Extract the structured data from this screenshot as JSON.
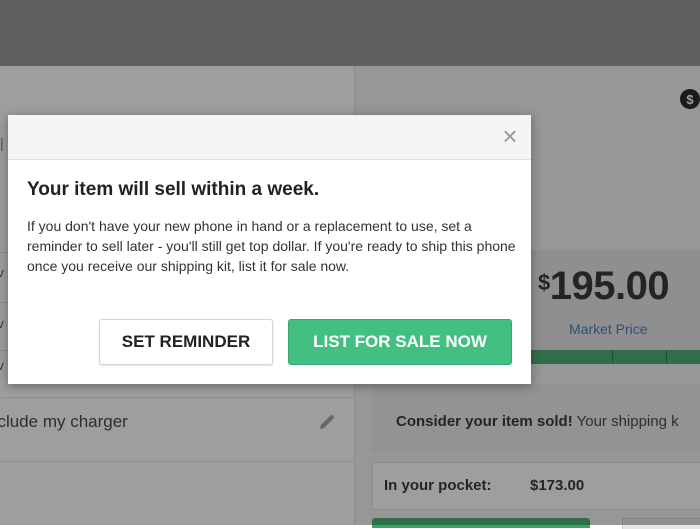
{
  "background": {
    "dollar_icon": "$",
    "rows": [
      {
        "text": "ev"
      },
      {
        "text": "ev"
      },
      {
        "text": "ev"
      },
      {
        "text": "nclude my charger"
      }
    ],
    "price": {
      "currency": "$",
      "amount": "195.00",
      "label": "Market Price"
    },
    "sold_box": {
      "bold": "Consider your item sold!",
      "text": " Your shipping k"
    },
    "pocket": {
      "label": "In your pocket:",
      "value": "$173.00"
    },
    "colors": {
      "accent_green": "#37a864",
      "link_blue": "#3b6fb6"
    }
  },
  "modal": {
    "close_icon": "close-icon",
    "title": "Your item will sell within a week.",
    "body": "If you don't have your new phone in hand or a replacement to use, set a reminder to sell later - you'll still get top dollar. If you're ready to ship this phone once you receive our shipping kit, list it for sale now.",
    "buttons": {
      "reminder": "SET REMINDER",
      "list": "LIST FOR SALE NOW"
    },
    "colors": {
      "primary": "#43c081"
    }
  }
}
